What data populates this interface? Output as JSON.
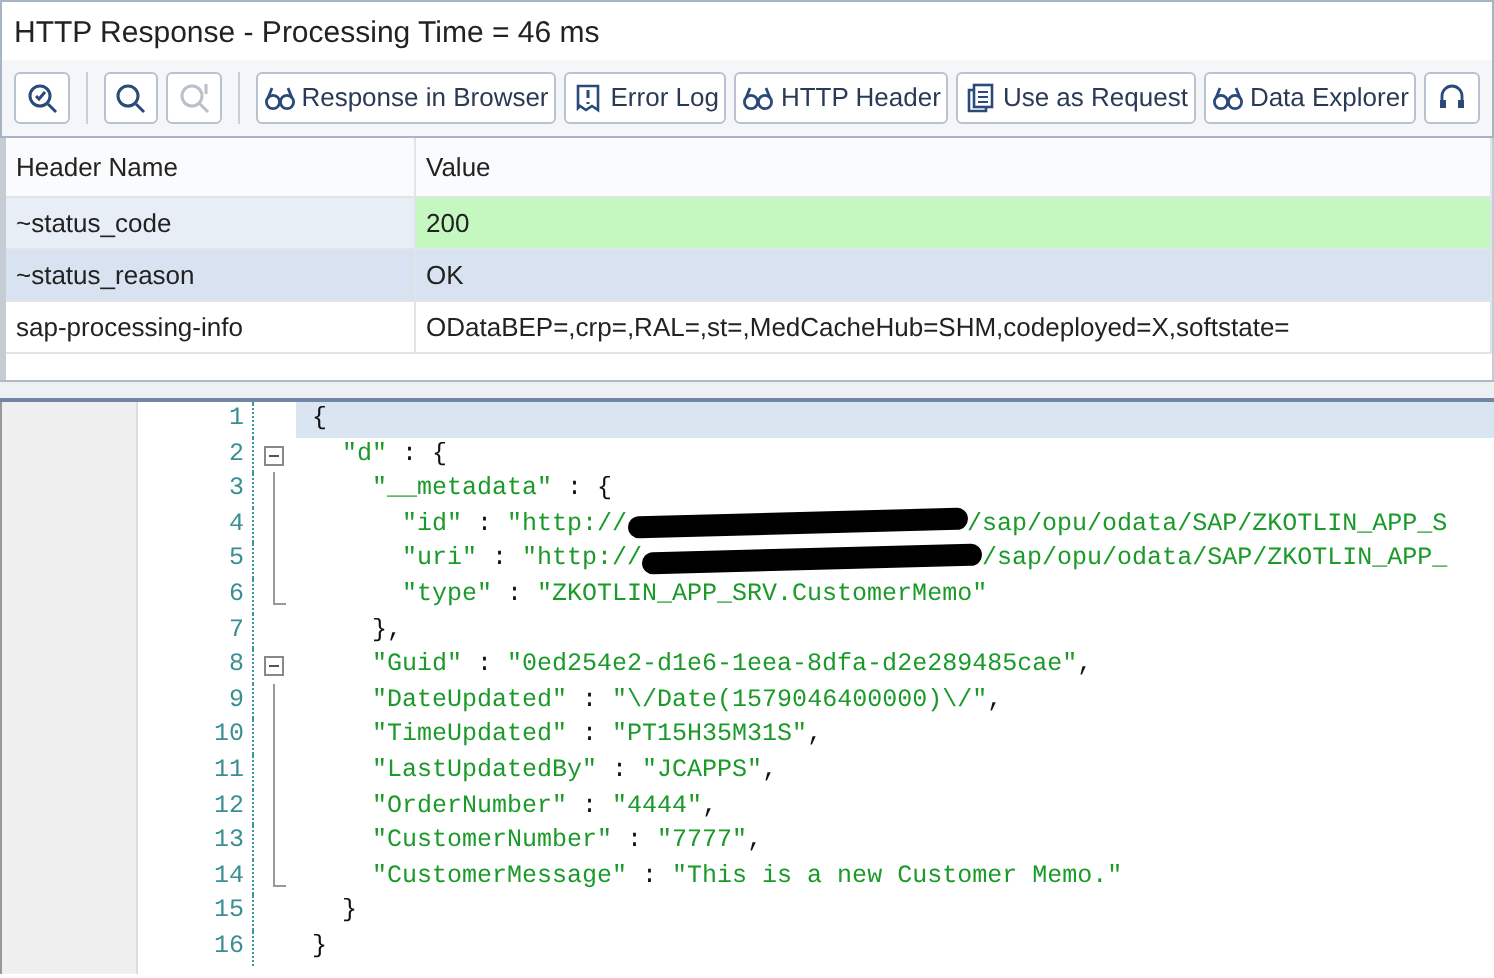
{
  "window": {
    "title": "HTTP Response - Processing Time = 46  ms"
  },
  "toolbar": [
    {
      "kind": "icon",
      "disabled": false
    },
    {
      "kind": "icon",
      "disabled": false
    },
    {
      "kind": "icon",
      "disabled": true
    },
    {
      "kind": "text",
      "label": "Response in Browser",
      "disabled": false
    },
    {
      "kind": "text",
      "label": "Error Log",
      "disabled": false
    },
    {
      "kind": "text",
      "label": "HTTP Header",
      "disabled": false
    },
    {
      "kind": "text",
      "label": "Use as Request",
      "disabled": false
    },
    {
      "kind": "text",
      "label": "Data Explorer",
      "disabled": false
    },
    {
      "kind": "icon",
      "disabled": false
    }
  ],
  "table": {
    "columns": [
      "Header Name",
      "Value"
    ],
    "rows": [
      {
        "name": "~status_code",
        "value": "200",
        "kind": "success"
      },
      {
        "name": "~status_reason",
        "value": "OK",
        "kind": "info"
      },
      {
        "name": "sap-processing-info",
        "value": "ODataBEP=,crp=,RAL=,st=,MedCacheHub=SHM,codeployed=X,softstate=",
        "kind": "plain"
      }
    ]
  },
  "editor": {
    "lines": [
      {
        "number": "1",
        "kind": "plain",
        "current": true,
        "segments": [
          {
            "kind": "punct",
            "text": "{"
          }
        ]
      },
      {
        "number": "2",
        "kind": "fold-start",
        "current": false,
        "segments": [
          {
            "kind": "str",
            "text": "  \"d\""
          },
          {
            "kind": "punct",
            "text": " : {"
          }
        ]
      },
      {
        "number": "3",
        "kind": "fold-line",
        "current": false,
        "segments": [
          {
            "kind": "str",
            "text": "    \"__metadata\""
          },
          {
            "kind": "punct",
            "text": " : {"
          }
        ]
      },
      {
        "number": "4",
        "kind": "fold-line",
        "current": false,
        "segments": [
          {
            "kind": "str",
            "text": "      \"id\""
          },
          {
            "kind": "punct",
            "text": " : "
          },
          {
            "kind": "str",
            "text": "\"http://"
          },
          {
            "kind": "redacted"
          },
          {
            "kind": "str",
            "text": "/sap/opu/odata/SAP/ZKOTLIN_APP_S"
          }
        ]
      },
      {
        "number": "5",
        "kind": "fold-line",
        "current": false,
        "segments": [
          {
            "kind": "str",
            "text": "      \"uri\""
          },
          {
            "kind": "punct",
            "text": " : "
          },
          {
            "kind": "str",
            "text": "\"http://"
          },
          {
            "kind": "redacted"
          },
          {
            "kind": "str",
            "text": "/sap/opu/odata/SAP/ZKOTLIN_APP_"
          }
        ]
      },
      {
        "number": "6",
        "kind": "fold-end",
        "current": false,
        "segments": [
          {
            "kind": "str",
            "text": "      \"type\""
          },
          {
            "kind": "punct",
            "text": " : "
          },
          {
            "kind": "str",
            "text": "\"ZKOTLIN_APP_SRV.CustomerMemo\""
          }
        ]
      },
      {
        "number": "7",
        "kind": "plain",
        "current": false,
        "segments": [
          {
            "kind": "punct",
            "text": "    },"
          }
        ]
      },
      {
        "number": "8",
        "kind": "fold-start",
        "current": false,
        "segments": [
          {
            "kind": "str",
            "text": "    \"Guid\""
          },
          {
            "kind": "punct",
            "text": " : "
          },
          {
            "kind": "str",
            "text": "\"0ed254e2-d1e6-1eea-8dfa-d2e289485cae\""
          },
          {
            "kind": "punct",
            "text": ","
          }
        ]
      },
      {
        "number": "9",
        "kind": "fold-line",
        "current": false,
        "segments": [
          {
            "kind": "str",
            "text": "    \"DateUpdated\""
          },
          {
            "kind": "punct",
            "text": " : "
          },
          {
            "kind": "str",
            "text": "\"\\/Date(1579046400000)\\/\""
          },
          {
            "kind": "punct",
            "text": ","
          }
        ]
      },
      {
        "number": "10",
        "kind": "fold-line",
        "current": false,
        "segments": [
          {
            "kind": "str",
            "text": "    \"TimeUpdated\""
          },
          {
            "kind": "punct",
            "text": " : "
          },
          {
            "kind": "str",
            "text": "\"PT15H35M31S\""
          },
          {
            "kind": "punct",
            "text": ","
          }
        ]
      },
      {
        "number": "11",
        "kind": "fold-line",
        "current": false,
        "segments": [
          {
            "kind": "str",
            "text": "    \"LastUpdatedBy\""
          },
          {
            "kind": "punct",
            "text": " : "
          },
          {
            "kind": "str",
            "text": "\"JCAPPS\""
          },
          {
            "kind": "punct",
            "text": ","
          }
        ]
      },
      {
        "number": "12",
        "kind": "fold-line",
        "current": false,
        "segments": [
          {
            "kind": "str",
            "text": "    \"OrderNumber\""
          },
          {
            "kind": "punct",
            "text": " : "
          },
          {
            "kind": "str",
            "text": "\"4444\""
          },
          {
            "kind": "punct",
            "text": ","
          }
        ]
      },
      {
        "number": "13",
        "kind": "fold-line",
        "current": false,
        "segments": [
          {
            "kind": "str",
            "text": "    \"CustomerNumber\""
          },
          {
            "kind": "punct",
            "text": " : "
          },
          {
            "kind": "str",
            "text": "\"7777\""
          },
          {
            "kind": "punct",
            "text": ","
          }
        ]
      },
      {
        "number": "14",
        "kind": "fold-end",
        "current": false,
        "segments": [
          {
            "kind": "str",
            "text": "    \"CustomerMessage\""
          },
          {
            "kind": "punct",
            "text": " : "
          },
          {
            "kind": "str",
            "text": "\"This is a new Customer Memo.\""
          }
        ]
      },
      {
        "number": "15",
        "kind": "plain",
        "current": false,
        "segments": [
          {
            "kind": "punct",
            "text": "  }"
          }
        ]
      },
      {
        "number": "16",
        "kind": "plain",
        "current": false,
        "segments": [
          {
            "kind": "punct",
            "text": "}"
          }
        ]
      }
    ]
  }
}
